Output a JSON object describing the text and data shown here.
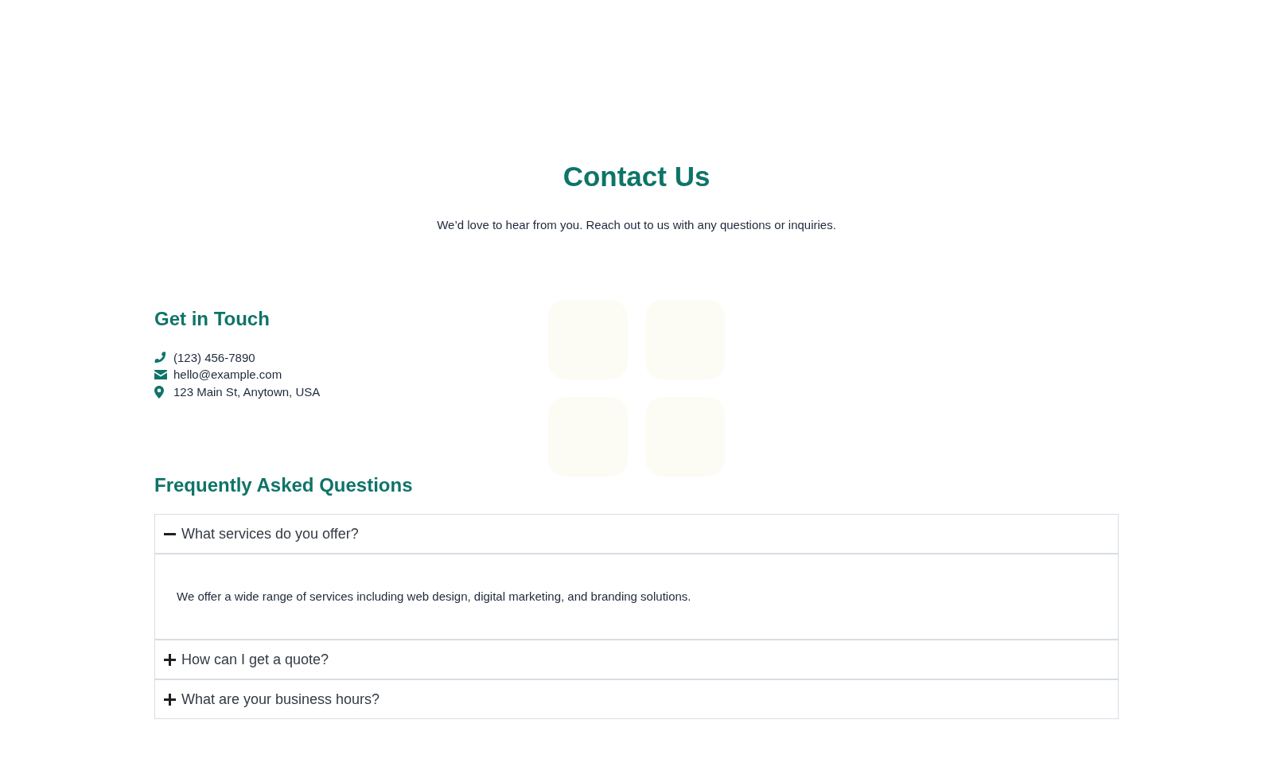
{
  "header": {
    "title": "Contact Us",
    "subtitle": "We’d love to hear from you. Reach out to us with any questions or inquiries."
  },
  "contact": {
    "heading": "Get in Touch",
    "items": [
      {
        "kind": "phone",
        "text": "(123) 456-7890"
      },
      {
        "kind": "email",
        "text": "hello@example.com"
      },
      {
        "kind": "address",
        "text": "123 Main St, Anytown, USA"
      }
    ]
  },
  "faq": {
    "heading": "Frequently Asked Questions",
    "items": [
      {
        "question": "What services do you offer?",
        "expanded": true,
        "answer": "We offer a wide range of services including web design, digital marketing, and branding solutions."
      },
      {
        "question": "How can I get a quote?",
        "expanded": false
      },
      {
        "question": "What are your business hours?",
        "expanded": false
      }
    ]
  }
}
